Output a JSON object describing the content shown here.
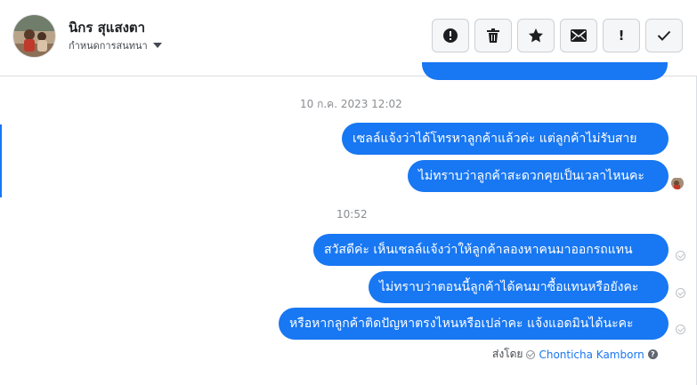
{
  "contact": {
    "name": "นิกร สุแสงตา",
    "assign_label": "กำหนดการสนทนา"
  },
  "toolbar": {
    "buttons": [
      {
        "icon": "alert-circle-icon"
      },
      {
        "icon": "trash-icon"
      },
      {
        "icon": "star-icon"
      },
      {
        "icon": "envelope-icon"
      },
      {
        "icon": "exclamation-icon",
        "label": "!"
      },
      {
        "icon": "checkmark-icon"
      }
    ]
  },
  "conversation": {
    "timestamps": [
      "10 ก.ค. 2023 12:02",
      "10:52"
    ],
    "group1": [
      "เซลล์แจ้งว่าได้โทรหาลูกค้าแล้วค่ะ แต่ลูกค้าไม่รับสาย",
      "ไม่ทราบว่าลูกค้าสะดวกคุยเป็นเวลาไหนคะ"
    ],
    "group2": [
      "สวัสดีค่ะ เห็นเซลล์แจ้งว่าให้ลูกค้าลองหาคนมาออกรถแทน",
      "ไม่ทราบว่าตอนนี้ลูกค้าได้คนมาซื้อแทนหรือยังคะ",
      "หรือหากลูกค้าติดปัญหาตรงไหนหรือเปล่าคะ แจ้งแอดมินได้นะคะ"
    ],
    "sent_by_label": "ส่งโดย",
    "sent_by_agent": "Chonticha Kamborn",
    "help_mark": "?"
  },
  "colors": {
    "bubble": "#1877f2",
    "bubble_text": "#ffffff",
    "timestamp": "#8a8d91"
  }
}
